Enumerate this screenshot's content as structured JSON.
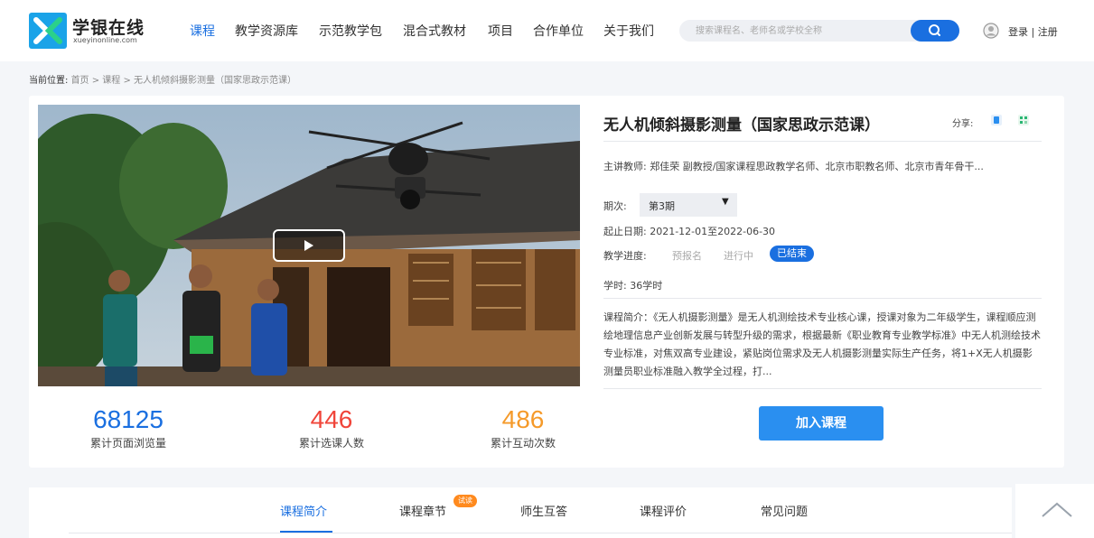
{
  "header": {
    "logo_name": "学银在线",
    "logo_url": "xueyinonline.com",
    "nav": [
      "课程",
      "教学资源库",
      "示范教学包",
      "混合式教材",
      "项目",
      "合作单位",
      "关于我们"
    ],
    "search_placeholder": "搜索课程名、老师名或学校全称",
    "login_text": "登录 | 注册"
  },
  "breadcrumb": {
    "label": "当前位置:",
    "path": "首页 > 课程 > 无人机倾斜摄影测量（国家思政示范课）"
  },
  "course": {
    "title": "无人机倾斜摄影测量（国家思政示范课）",
    "share_label": "分享:",
    "teacher": "主讲教师: 郑佳荣 副教授/国家课程思政教学名师、北京市职教名师、北京市青年骨干...",
    "term_label": "期次:",
    "term_value": "第3期",
    "date": "起止日期: 2021-12-01至2022-06-30",
    "progress_label": "教学进度:",
    "progress_options": [
      "预报名",
      "进行中"
    ],
    "progress_active": "已结束",
    "hours": "学时: 36学时",
    "intro": "课程简介：《无人机摄影测量》是无人机测绘技术专业核心课，授课对象为二年级学生，课程顺应测绘地理信息产业创新发展与转型升级的需求，根据最新《职业教育专业教学标准》中无人机测绘技术专业标准，对焦双高专业建设，紧贴岗位需求及无人机摄影测量实际生产任务，将1+X无人机摄影测量员职业标准融入教学全过程，打...",
    "join_label": "加入课程"
  },
  "stats": [
    {
      "value": "68125",
      "label": "累计页面浏览量",
      "color": "#1a6fe0"
    },
    {
      "value": "446",
      "label": "累计选课人数",
      "color": "#f0453a"
    },
    {
      "value": "486",
      "label": "累计互动次数",
      "color": "#f59a2a"
    }
  ],
  "tabs": {
    "items": [
      "课程简介",
      "课程章节",
      "师生互答",
      "课程评价",
      "常见问题"
    ],
    "badge": "试读"
  },
  "colors": {
    "accent": "#1a6fe0",
    "button": "#2a8ff0",
    "badge": "#ff8a1e"
  }
}
